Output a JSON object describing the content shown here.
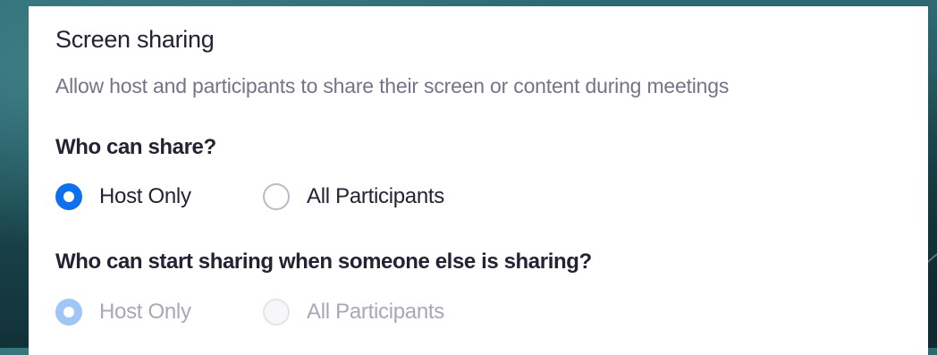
{
  "setting": {
    "title": "Screen sharing",
    "description": "Allow host and participants to share their screen or content during meetings"
  },
  "who_can_share": {
    "question": "Who can share?",
    "options": [
      {
        "label": "Host Only",
        "selected": true,
        "disabled": false
      },
      {
        "label": "All Participants",
        "selected": false,
        "disabled": false
      }
    ]
  },
  "who_can_start_sharing": {
    "question": "Who can start sharing when someone else is sharing?",
    "options": [
      {
        "label": "Host Only",
        "selected": true,
        "disabled": true
      },
      {
        "label": "All Participants",
        "selected": false,
        "disabled": true
      }
    ]
  },
  "colors": {
    "accent": "#0e71eb",
    "accent_disabled": "#9fc6f5",
    "text_primary": "#232333",
    "text_secondary": "#747487",
    "text_disabled": "#a8a8b4"
  }
}
